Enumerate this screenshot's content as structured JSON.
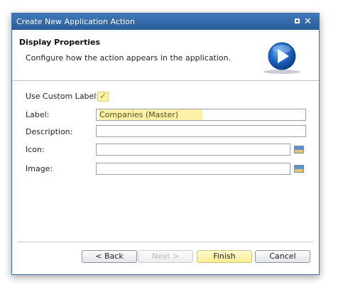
{
  "window": {
    "title": "Create New Application Action"
  },
  "header": {
    "title": "Display Properties",
    "description": "Configure how the action appears in the application."
  },
  "form": {
    "use_custom_label": {
      "label": "Use Custom Label:",
      "checked": true,
      "check_mark": "✓"
    },
    "label_field": {
      "label": "Label:",
      "value": "Companies (Master)"
    },
    "description_field": {
      "label": "Description:",
      "value": ""
    },
    "icon_field": {
      "label": "Icon:",
      "value": ""
    },
    "image_field": {
      "label": "Image:",
      "value": ""
    }
  },
  "buttons": {
    "back": "< Back",
    "next": "Next >",
    "finish": "Finish",
    "cancel": "Cancel"
  },
  "colors": {
    "title_bar": "#2f65a8",
    "highlight": "#fbf2a8",
    "play_icon": "#1e66c4"
  },
  "icons": {
    "maximize": "maximize-icon",
    "close": "close-icon",
    "header_graphic": "play-circle-icon",
    "picker": "image-picker-icon"
  }
}
